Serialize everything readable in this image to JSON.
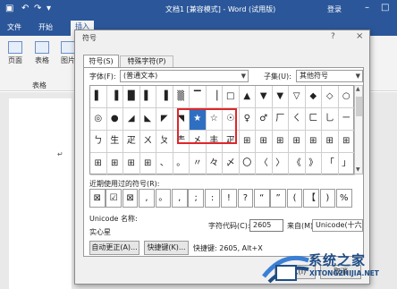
{
  "window": {
    "title": "文档1 [兼容模式] - Word (试用版)",
    "login": "登录",
    "min": "–",
    "restore": "□",
    "close": "×"
  },
  "tabs": [
    "文件",
    "开始",
    "插入",
    "设计",
    "布局",
    "引用",
    "邮件",
    "审阅",
    "视图"
  ],
  "ribbon": {
    "items": [
      "页面",
      "表格",
      "图片"
    ],
    "group": "表格"
  },
  "dialog": {
    "title": "符号",
    "help": "?",
    "close": "×",
    "tab_symbols": "符号(S)",
    "tab_special": "特殊字符(P)",
    "font_label": "字体(F):",
    "font_value": "(普通文本)",
    "subset_label": "子集(U):",
    "subset_value": "其他符号",
    "symbols": [
      "▌",
      "▐",
      "█",
      "▌",
      "▐",
      "▒",
      "▔",
      "▕",
      "□",
      "▲",
      "▼",
      "▼",
      "▽",
      "◆",
      "◇",
      "○",
      "◎",
      "●",
      "◢",
      "◣",
      "◤",
      "◥",
      "★",
      "☆",
      "☉",
      "♀",
      "♂",
      "厂",
      "ㄑ",
      "ㄈ",
      "乚",
      "ㄧ",
      "ㄅ",
      "生",
      "疋",
      "ㄨ",
      "ㄆ",
      "龶",
      "㐅",
      "丰",
      "疋",
      "⊞",
      "⊞",
      "⊞",
      "⊞",
      "⊞",
      "⊞",
      "⊞",
      "⊞",
      "⊞",
      "⊞",
      "⊞",
      "、",
      "。",
      "〃",
      "々",
      "〆",
      "〇",
      "〈",
      "〉",
      "《",
      "》",
      "「",
      "」"
    ],
    "selected_index": 22,
    "recent_label": "近期使用过的符号(R):",
    "recent": [
      "⊠",
      "☑",
      "⊠",
      ",",
      "。",
      ",",
      ";",
      ":",
      "!",
      "?",
      "“",
      "”",
      "(",
      "【",
      ")",
      "%"
    ],
    "unicode_name_label": "Unicode 名称:",
    "unicode_name": "实心星",
    "charcode_label": "字符代码(C):",
    "charcode_value": "2605",
    "from_label": "来自(M):",
    "from_value": "Unicode(十六进",
    "autocorrect_button": "自动更正(A)...",
    "shortcut_button": "快捷键(K)...",
    "shortcut_text": "快捷键: 2605, Alt+X",
    "insert_button": "插入(I)",
    "cancel_button": "取消"
  },
  "watermark": {
    "text": "系统之家",
    "url": "XITONGZHIJIA.NET"
  },
  "colors": {
    "word_blue": "#2b579a",
    "selection": "#2f6fc1",
    "highlight_box": "#e0262b"
  }
}
